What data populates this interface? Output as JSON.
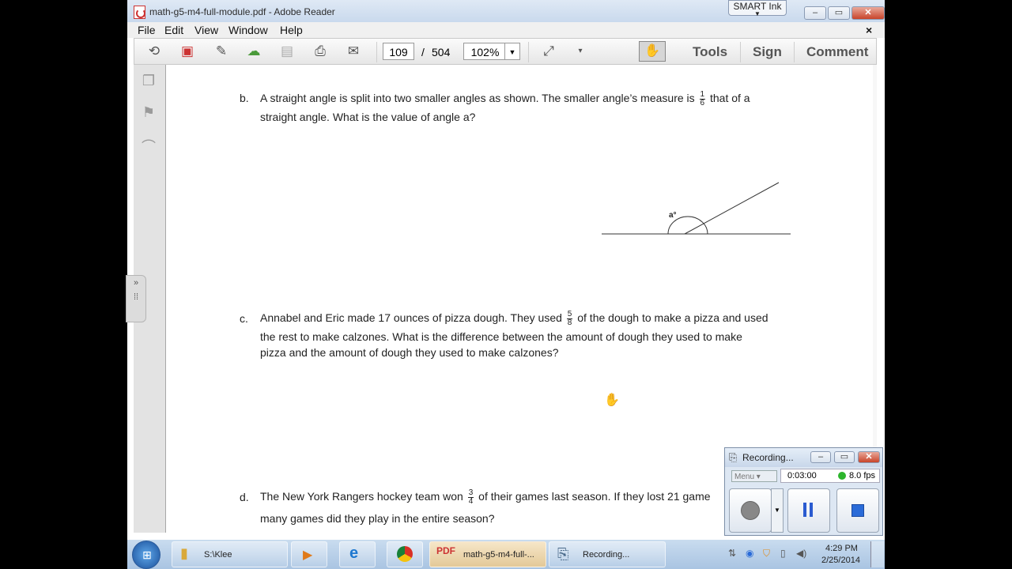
{
  "window": {
    "title": "math-g5-m4-full-module.pdf - Adobe Reader",
    "smart_ink": "SMART Ink",
    "close_x": "×"
  },
  "menu": [
    "File",
    "Edit",
    "View",
    "Window",
    "Help"
  ],
  "toolbar": {
    "page_current": "109",
    "page_separator": "/",
    "page_total": "504",
    "zoom": "102%",
    "tools": "Tools",
    "sign": "Sign",
    "comment": "Comment"
  },
  "problems": {
    "b": {
      "letter": "b.",
      "text_before": "A straight angle is split into two smaller angles as shown.  The smaller angle’s measure is",
      "frac_num": "1",
      "frac_den": "6",
      "text_after": "that of a",
      "line2": "straight angle.  What is the value of angle a?",
      "angle_label": "a°"
    },
    "c": {
      "letter": "c.",
      "text_before": "Annabel and Eric made 17 ounces of pizza dough.  They used",
      "frac_num": "5",
      "frac_den": "8",
      "text_after": "of the dough to make a pizza and used",
      "line2": "the rest to make calzones.  What is the difference between the amount of dough they used to make",
      "line3": "pizza and the amount of dough they used to make calzones?"
    },
    "d": {
      "letter": "d.",
      "text_before": "The New York Rangers hockey team won",
      "frac_num": "3",
      "frac_den": "4",
      "text_after": "of their games last season.  If they lost 21 game",
      "line2": "many games did they play in the entire season?"
    }
  },
  "recording": {
    "title": "Recording...",
    "menu": "Menu",
    "time": "0:03:00",
    "fps": "8.0 fps"
  },
  "taskbar": {
    "tasks": [
      {
        "label": "S:\\Klee"
      },
      {
        "label": "math-g5-m4-full-..."
      },
      {
        "label": "Recording..."
      }
    ],
    "time": "4:29 PM",
    "date": "2/25/2014"
  }
}
